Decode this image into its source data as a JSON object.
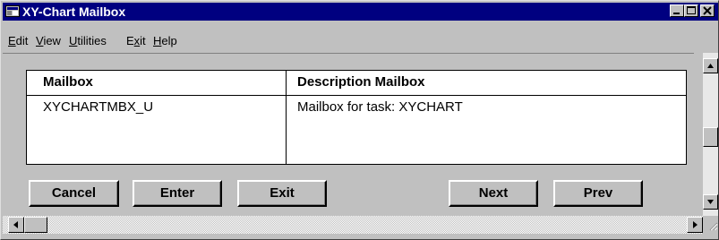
{
  "window": {
    "title": "XY-Chart Mailbox"
  },
  "menu": {
    "items": [
      {
        "pre": "",
        "ul": "E",
        "post": "dit"
      },
      {
        "pre": "",
        "ul": "V",
        "post": "iew"
      },
      {
        "pre": "",
        "ul": "U",
        "post": "tilities"
      },
      {
        "pre": "E",
        "ul": "x",
        "post": "it"
      },
      {
        "pre": "",
        "ul": "H",
        "post": "elp"
      }
    ]
  },
  "table": {
    "headers": [
      "Mailbox",
      "Description Mailbox"
    ],
    "rows": [
      [
        "XYCHARTMBX_U",
        "Mailbox for task: XYCHART"
      ]
    ]
  },
  "buttons": {
    "cancel": "Cancel",
    "enter": "Enter",
    "exit": "Exit",
    "next": "Next",
    "prev": "Prev"
  },
  "icons": {
    "system": "application-icon",
    "minimize": "minimize-icon",
    "maximize": "maximize-icon",
    "close": "close-icon",
    "scroll_up": "arrow-up-icon",
    "scroll_down": "arrow-down-icon",
    "scroll_left": "arrow-left-icon",
    "scroll_right": "arrow-right-icon"
  },
  "colors": {
    "titlebar": "#000080",
    "face": "#c0c0c0"
  }
}
